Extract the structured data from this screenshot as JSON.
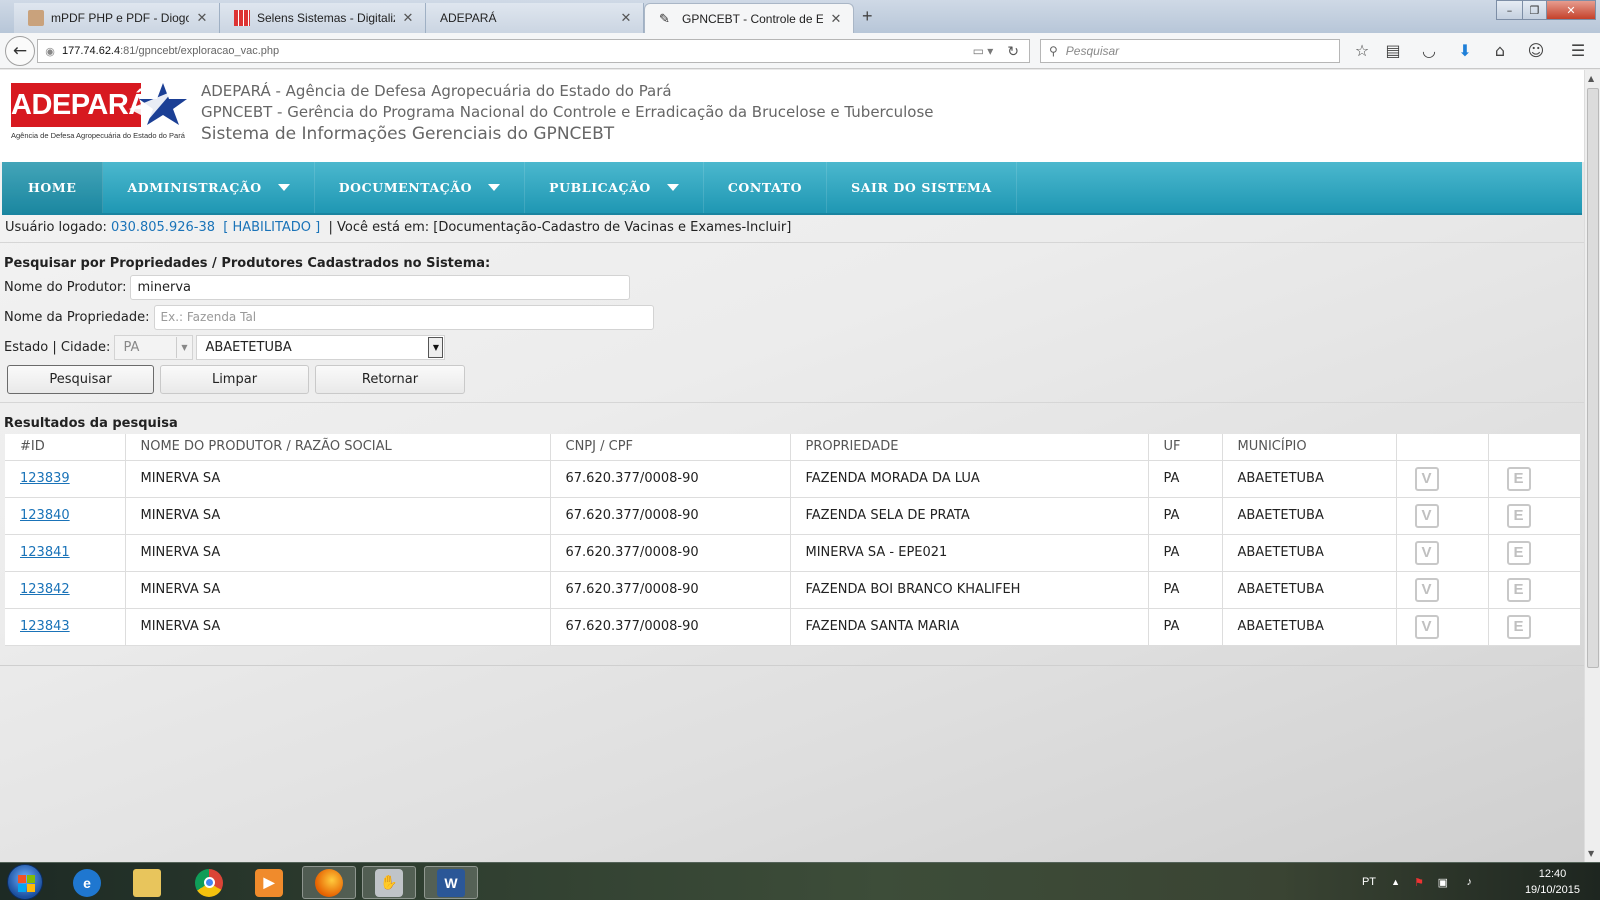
{
  "browser": {
    "tabs": [
      {
        "label": "mPDF PHP e PDF - Diogo ...",
        "active": false
      },
      {
        "label": "Selens Sistemas - Digitaliza...",
        "active": false
      },
      {
        "label": "ADEPARÁ",
        "active": false
      },
      {
        "label": "GPNCEBT - Controle de E...",
        "active": true
      }
    ],
    "new_tab": "+",
    "window_controls": {
      "minimize": "–",
      "maximize": "❐",
      "close": "✕"
    },
    "url_host": "177.74.62.4",
    "url_rest": ":81/gpncebt/exploracao_vac.php",
    "search_placeholder": "Pesquisar",
    "toolbar_icons": [
      "star-icon",
      "reading-list-icon",
      "pocket-icon",
      "download-icon",
      "home-icon",
      "chat-icon",
      "menu-icon"
    ]
  },
  "header": {
    "logo_text": "ADEPARÁ",
    "logo_caption": "Agência de Defesa Agropecuária do Estado do Pará",
    "line1": "ADEPARÁ - Agência de Defesa Agropecuária do Estado do Pará",
    "line2": "GPNCEBT - Gerência do Programa Nacional do Controle e Erradicação da Brucelose e Tuberculose",
    "line3": "Sistema de Informações Gerenciais do GPNCEBT"
  },
  "menu": [
    {
      "label": "HOME",
      "dropdown": false
    },
    {
      "label": "ADMINISTRAÇÃO",
      "dropdown": true
    },
    {
      "label": "DOCUMENTAÇÃO",
      "dropdown": true
    },
    {
      "label": "PUBLICAÇÃO",
      "dropdown": true
    },
    {
      "label": "CONTATO",
      "dropdown": false
    },
    {
      "label": "SAIR DO SISTEMA",
      "dropdown": false
    }
  ],
  "status": {
    "logged_label": "Usuário logado:",
    "user": "030.805.926-38",
    "state": "[ HABILITADO ]",
    "location": "| Você está em: [Documentação-Cadastro de Vacinas e Exames-Incluir]"
  },
  "form": {
    "title": "Pesquisar por Propriedades / Produtores Cadastrados no Sistema:",
    "producer_label": "Nome do Produtor:",
    "producer_value": "minerva",
    "property_label": "Nome da Propriedade:",
    "property_placeholder": "Ex.: Fazenda Tal",
    "location_label": "Estado | Cidade:",
    "state_value": "PA",
    "city_value": "ABAETETUBA",
    "buttons": {
      "search": "Pesquisar",
      "clear": "Limpar",
      "back": "Retornar"
    }
  },
  "results": {
    "title": "Resultados da pesquisa",
    "columns": [
      "#ID",
      "NOME DO PRODUTOR / RAZÃO SOCIAL",
      "CNPJ / CPF",
      "PROPRIEDADE",
      "UF",
      "MUNICÍPIO",
      "",
      ""
    ],
    "rows": [
      {
        "id": "123839",
        "nome": "MINERVA SA",
        "doc": "67.620.377/0008-90",
        "propriedade": "FAZENDA MORADA DA LUA",
        "uf": "PA",
        "municipio": "ABAETETUBA"
      },
      {
        "id": "123840",
        "nome": "MINERVA SA",
        "doc": "67.620.377/0008-90",
        "propriedade": "FAZENDA SELA DE PRATA",
        "uf": "PA",
        "municipio": "ABAETETUBA"
      },
      {
        "id": "123841",
        "nome": "MINERVA SA",
        "doc": "67.620.377/0008-90",
        "propriedade": "MINERVA SA - EPE021",
        "uf": "PA",
        "municipio": "ABAETETUBA"
      },
      {
        "id": "123842",
        "nome": "MINERVA SA",
        "doc": "67.620.377/0008-90",
        "propriedade": "FAZENDA BOI BRANCO KHALIFEH",
        "uf": "PA",
        "municipio": "ABAETETUBA"
      },
      {
        "id": "123843",
        "nome": "MINERVA SA",
        "doc": "67.620.377/0008-90",
        "propriedade": "FAZENDA SANTA MARIA",
        "uf": "PA",
        "municipio": "ABAETETUBA"
      }
    ],
    "view_icon": "V",
    "edit_icon": "E"
  },
  "taskbar": {
    "apps": [
      "internet-explorer-icon",
      "file-explorer-icon",
      "chrome-icon",
      "media-player-icon",
      "firefox-icon",
      "network-app-icon",
      "word-icon"
    ],
    "language": "PT",
    "time": "12:40",
    "date": "19/10/2015"
  },
  "colors": {
    "menu": "#2aa4c0",
    "brand_red": "#d71920",
    "link": "#1a73b8"
  }
}
